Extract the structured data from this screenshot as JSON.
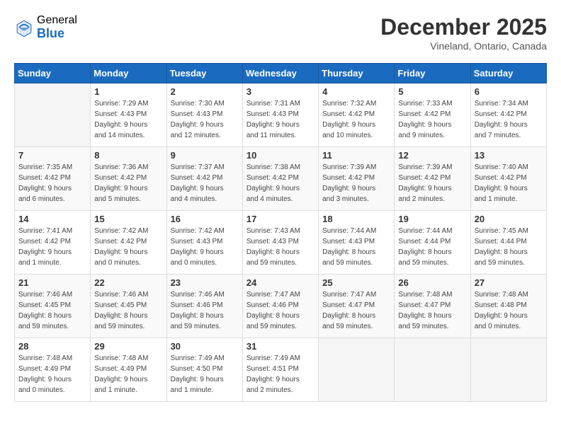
{
  "logo": {
    "general": "General",
    "blue": "Blue"
  },
  "title": {
    "month": "December 2025",
    "location": "Vineland, Ontario, Canada"
  },
  "headers": [
    "Sunday",
    "Monday",
    "Tuesday",
    "Wednesday",
    "Thursday",
    "Friday",
    "Saturday"
  ],
  "weeks": [
    [
      {
        "day": "",
        "info": ""
      },
      {
        "day": "1",
        "info": "Sunrise: 7:29 AM\nSunset: 4:43 PM\nDaylight: 9 hours\nand 14 minutes."
      },
      {
        "day": "2",
        "info": "Sunrise: 7:30 AM\nSunset: 4:43 PM\nDaylight: 9 hours\nand 12 minutes."
      },
      {
        "day": "3",
        "info": "Sunrise: 7:31 AM\nSunset: 4:43 PM\nDaylight: 9 hours\nand 11 minutes."
      },
      {
        "day": "4",
        "info": "Sunrise: 7:32 AM\nSunset: 4:42 PM\nDaylight: 9 hours\nand 10 minutes."
      },
      {
        "day": "5",
        "info": "Sunrise: 7:33 AM\nSunset: 4:42 PM\nDaylight: 9 hours\nand 9 minutes."
      },
      {
        "day": "6",
        "info": "Sunrise: 7:34 AM\nSunset: 4:42 PM\nDaylight: 9 hours\nand 7 minutes."
      }
    ],
    [
      {
        "day": "7",
        "info": "Sunrise: 7:35 AM\nSunset: 4:42 PM\nDaylight: 9 hours\nand 6 minutes."
      },
      {
        "day": "8",
        "info": "Sunrise: 7:36 AM\nSunset: 4:42 PM\nDaylight: 9 hours\nand 5 minutes."
      },
      {
        "day": "9",
        "info": "Sunrise: 7:37 AM\nSunset: 4:42 PM\nDaylight: 9 hours\nand 4 minutes."
      },
      {
        "day": "10",
        "info": "Sunrise: 7:38 AM\nSunset: 4:42 PM\nDaylight: 9 hours\nand 4 minutes."
      },
      {
        "day": "11",
        "info": "Sunrise: 7:39 AM\nSunset: 4:42 PM\nDaylight: 9 hours\nand 3 minutes."
      },
      {
        "day": "12",
        "info": "Sunrise: 7:39 AM\nSunset: 4:42 PM\nDaylight: 9 hours\nand 2 minutes."
      },
      {
        "day": "13",
        "info": "Sunrise: 7:40 AM\nSunset: 4:42 PM\nDaylight: 9 hours\nand 1 minute."
      }
    ],
    [
      {
        "day": "14",
        "info": "Sunrise: 7:41 AM\nSunset: 4:42 PM\nDaylight: 9 hours\nand 1 minute."
      },
      {
        "day": "15",
        "info": "Sunrise: 7:42 AM\nSunset: 4:42 PM\nDaylight: 9 hours\nand 0 minutes."
      },
      {
        "day": "16",
        "info": "Sunrise: 7:42 AM\nSunset: 4:43 PM\nDaylight: 9 hours\nand 0 minutes."
      },
      {
        "day": "17",
        "info": "Sunrise: 7:43 AM\nSunset: 4:43 PM\nDaylight: 8 hours\nand 59 minutes."
      },
      {
        "day": "18",
        "info": "Sunrise: 7:44 AM\nSunset: 4:43 PM\nDaylight: 8 hours\nand 59 minutes."
      },
      {
        "day": "19",
        "info": "Sunrise: 7:44 AM\nSunset: 4:44 PM\nDaylight: 8 hours\nand 59 minutes."
      },
      {
        "day": "20",
        "info": "Sunrise: 7:45 AM\nSunset: 4:44 PM\nDaylight: 8 hours\nand 59 minutes."
      }
    ],
    [
      {
        "day": "21",
        "info": "Sunrise: 7:46 AM\nSunset: 4:45 PM\nDaylight: 8 hours\nand 59 minutes."
      },
      {
        "day": "22",
        "info": "Sunrise: 7:46 AM\nSunset: 4:45 PM\nDaylight: 8 hours\nand 59 minutes."
      },
      {
        "day": "23",
        "info": "Sunrise: 7:46 AM\nSunset: 4:46 PM\nDaylight: 8 hours\nand 59 minutes."
      },
      {
        "day": "24",
        "info": "Sunrise: 7:47 AM\nSunset: 4:46 PM\nDaylight: 8 hours\nand 59 minutes."
      },
      {
        "day": "25",
        "info": "Sunrise: 7:47 AM\nSunset: 4:47 PM\nDaylight: 8 hours\nand 59 minutes."
      },
      {
        "day": "26",
        "info": "Sunrise: 7:48 AM\nSunset: 4:47 PM\nDaylight: 8 hours\nand 59 minutes."
      },
      {
        "day": "27",
        "info": "Sunrise: 7:48 AM\nSunset: 4:48 PM\nDaylight: 9 hours\nand 0 minutes."
      }
    ],
    [
      {
        "day": "28",
        "info": "Sunrise: 7:48 AM\nSunset: 4:49 PM\nDaylight: 9 hours\nand 0 minutes."
      },
      {
        "day": "29",
        "info": "Sunrise: 7:48 AM\nSunset: 4:49 PM\nDaylight: 9 hours\nand 1 minute."
      },
      {
        "day": "30",
        "info": "Sunrise: 7:49 AM\nSunset: 4:50 PM\nDaylight: 9 hours\nand 1 minute."
      },
      {
        "day": "31",
        "info": "Sunrise: 7:49 AM\nSunset: 4:51 PM\nDaylight: 9 hours\nand 2 minutes."
      },
      {
        "day": "",
        "info": ""
      },
      {
        "day": "",
        "info": ""
      },
      {
        "day": "",
        "info": ""
      }
    ]
  ]
}
